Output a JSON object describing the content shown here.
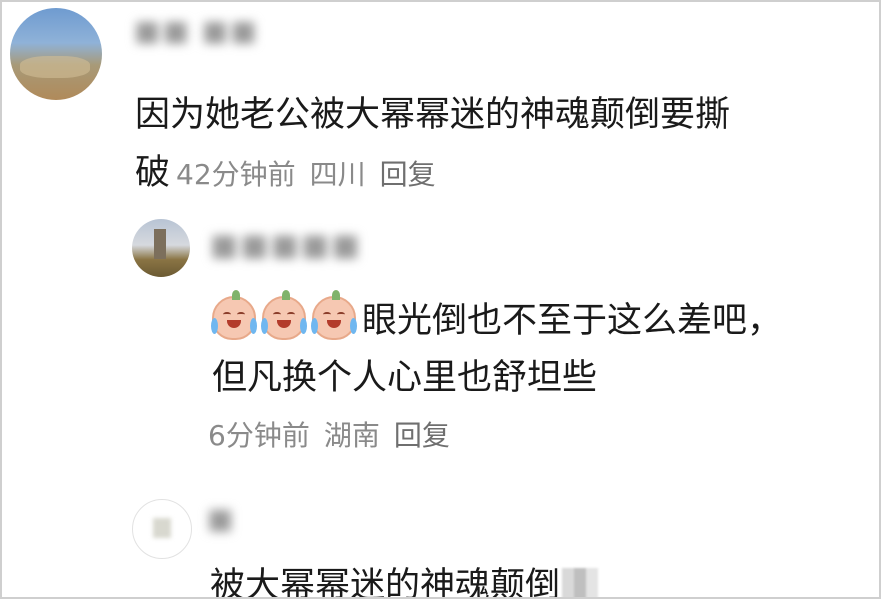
{
  "comments": [
    {
      "username": "■■ ■■",
      "text_line1": "因为她老公被大幂幂迷的神魂颠倒要撕",
      "text_line2": "破",
      "time": "42分钟前",
      "location": "四川",
      "reply_label": "回复"
    }
  ],
  "replies": [
    {
      "username": "■■■■■",
      "emojis": [
        "crying-face-emoji",
        "crying-face-emoji",
        "crying-face-emoji"
      ],
      "text_line1": "眼光倒也不至于这么差吧，",
      "text_line2": "但凡换个人心里也舒坦些",
      "time": "6分钟前",
      "location": "湖南",
      "reply_label": "回复"
    },
    {
      "username": "■",
      "text_line1": "被大幂幂迷的神魂颠倒"
    }
  ]
}
